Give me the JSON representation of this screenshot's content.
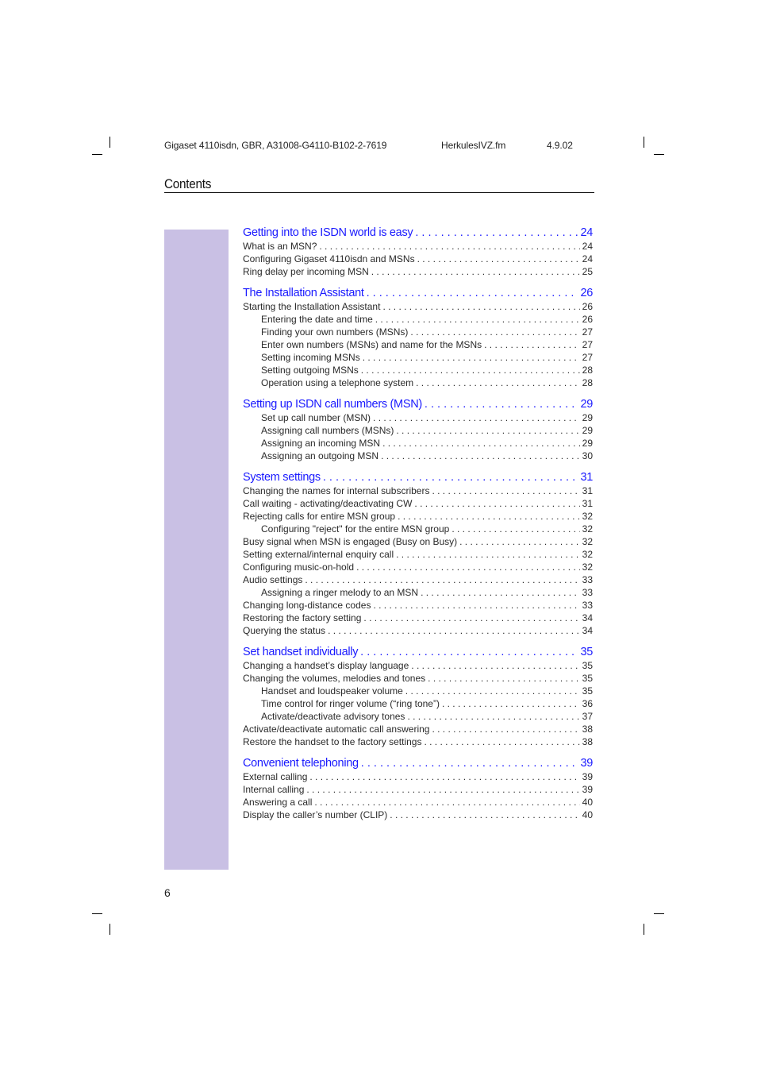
{
  "header": {
    "document_id": "Gigaset 4110isdn, GBR, A31008-G4110-B102-2-7619",
    "file_name": "HerkulesIVZ.fm",
    "date": "4.9.02"
  },
  "page_title": "Contents",
  "page_number": "6",
  "colors": {
    "chapter_link": "#1a1aff",
    "side_band": "#c9c0e4",
    "text": "#2a2a2a"
  },
  "toc": [
    {
      "title": "Getting into the ISDN world is easy",
      "page": "24",
      "entries": [
        {
          "label": "What is an MSN?",
          "page": "24",
          "level": 1
        },
        {
          "label": "Configuring Gigaset 4110isdn and MSNs",
          "page": "24",
          "level": 1
        },
        {
          "label": "Ring delay per incoming MSN",
          "page": "25",
          "level": 1
        }
      ]
    },
    {
      "title": "The Installation Assistant",
      "page": "26",
      "entries": [
        {
          "label": "Starting the Installation Assistant",
          "page": "26",
          "level": 1
        },
        {
          "label": "Entering the date and time",
          "page": "26",
          "level": 2
        },
        {
          "label": "Finding your own numbers (MSNs)",
          "page": "27",
          "level": 2
        },
        {
          "label": "Enter own numbers (MSNs) and name for the MSNs",
          "page": "27",
          "level": 2
        },
        {
          "label": "Setting incoming MSNs",
          "page": "27",
          "level": 2
        },
        {
          "label": "Setting outgoing MSNs",
          "page": "28",
          "level": 2
        },
        {
          "label": "Operation using a telephone system",
          "page": "28",
          "level": 2
        }
      ]
    },
    {
      "title": "Setting up ISDN call numbers (MSN)",
      "page": "29",
      "entries": [
        {
          "label": "Set up call number (MSN)",
          "page": "29",
          "level": 2
        },
        {
          "label": "Assigning call numbers (MSNs)",
          "page": "29",
          "level": 2
        },
        {
          "label": "Assigning an incoming MSN",
          "page": "29",
          "level": 2
        },
        {
          "label": "Assigning an outgoing MSN",
          "page": "30",
          "level": 2
        }
      ]
    },
    {
      "title": "System settings",
      "page": "31",
      "entries": [
        {
          "label": "Changing the names for internal subscribers",
          "page": "31",
          "level": 1
        },
        {
          "label": "Call waiting - activating/deactivating CW",
          "page": "31",
          "level": 1
        },
        {
          "label": "Rejecting calls for entire MSN group",
          "page": "32",
          "level": 1
        },
        {
          "label": "Configuring \"reject\" for the entire MSN group",
          "page": "32",
          "level": 2
        },
        {
          "label": "Busy signal when MSN is engaged (Busy on Busy)",
          "page": "32",
          "level": 1
        },
        {
          "label": "Setting external/internal enquiry call",
          "page": "32",
          "level": 1
        },
        {
          "label": "Configuring music-on-hold",
          "page": "32",
          "level": 1
        },
        {
          "label": "Audio settings",
          "page": "33",
          "level": 1
        },
        {
          "label": "Assigning a ringer melody to an MSN",
          "page": "33",
          "level": 2
        },
        {
          "label": "Changing long-distance codes",
          "page": "33",
          "level": 1
        },
        {
          "label": "Restoring the factory setting",
          "page": "34",
          "level": 1
        },
        {
          "label": "Querying the status",
          "page": "34",
          "level": 1
        }
      ]
    },
    {
      "title": "Set handset individually",
      "page": "35",
      "entries": [
        {
          "label": "Changing a handset’s display language",
          "page": "35",
          "level": 1
        },
        {
          "label": "Changing the volumes, melodies and tones",
          "page": "35",
          "level": 1
        },
        {
          "label": "Handset and loudspeaker volume",
          "page": "35",
          "level": 2
        },
        {
          "label": "Time control for ringer volume (“ring tone”)",
          "page": "36",
          "level": 2
        },
        {
          "label": "Activate/deactivate advisory tones",
          "page": "37",
          "level": 2
        },
        {
          "label": "Activate/deactivate automatic call answering",
          "page": "38",
          "level": 1
        },
        {
          "label": "Restore the handset to the factory settings",
          "page": "38",
          "level": 1
        }
      ]
    },
    {
      "title": "Convenient telephoning",
      "page": "39",
      "entries": [
        {
          "label": "External calling",
          "page": "39",
          "level": 1
        },
        {
          "label": "Internal calling",
          "page": "39",
          "level": 1
        },
        {
          "label": "Answering a call",
          "page": "40",
          "level": 1
        },
        {
          "label": "Display the caller’s number (CLIP)",
          "page": "40",
          "level": 1
        }
      ]
    }
  ]
}
